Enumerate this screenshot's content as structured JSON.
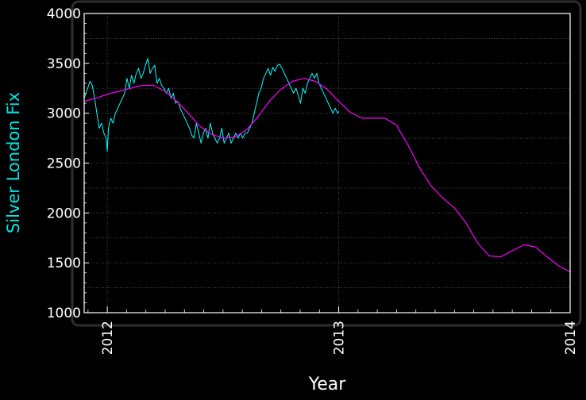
{
  "chart_data": {
    "type": "line",
    "title": "",
    "xlabel": "Year",
    "ylabel": "Silver London Fix",
    "xlim": [
      2011.9,
      2014.0
    ],
    "ylim": [
      1000,
      4000
    ],
    "yticks": [
      1000,
      1500,
      2000,
      2500,
      3000,
      3500,
      4000
    ],
    "ytick_labels": [
      "1000",
      "1500",
      "2000",
      "2500",
      "3000",
      "3500",
      "4000"
    ],
    "xticks": [
      2012,
      2013,
      2014
    ],
    "xtick_labels": [
      "2012",
      "2013",
      "2014"
    ],
    "grid": true,
    "legend": "none",
    "colors": {
      "background": "#000000",
      "plot_border": "#ffffff",
      "grid": "#555555",
      "ylabel": "#00e5e5",
      "text": "#ffffff"
    },
    "series": [
      {
        "color": "#00ffff",
        "x": [
          2011.9,
          2011.915,
          2011.925,
          2011.935,
          2011.945,
          2011.955,
          2011.965,
          2011.975,
          2011.985,
          2011.995,
          2012.0,
          2012.005,
          2012.015,
          2012.025,
          2012.035,
          2012.045,
          2012.055,
          2012.065,
          2012.075,
          2012.085,
          2012.095,
          2012.105,
          2012.115,
          2012.125,
          2012.135,
          2012.145,
          2012.155,
          2012.165,
          2012.175,
          2012.185,
          2012.195,
          2012.205,
          2012.215,
          2012.225,
          2012.235,
          2012.245,
          2012.255,
          2012.265,
          2012.275,
          2012.285,
          2012.295,
          2012.305,
          2012.315,
          2012.325,
          2012.335,
          2012.345,
          2012.355,
          2012.365,
          2012.375,
          2012.385,
          2012.395,
          2012.405,
          2012.415,
          2012.425,
          2012.435,
          2012.445,
          2012.455,
          2012.465,
          2012.475,
          2012.485,
          2012.495,
          2012.505,
          2012.515,
          2012.525,
          2012.535,
          2012.545,
          2012.555,
          2012.565,
          2012.575,
          2012.585,
          2012.595,
          2012.605,
          2012.615,
          2012.625,
          2012.635,
          2012.645,
          2012.655,
          2012.665,
          2012.675,
          2012.685,
          2012.695,
          2012.705,
          2012.715,
          2012.725,
          2012.735,
          2012.745,
          2012.755,
          2012.765,
          2012.775,
          2012.785,
          2012.795,
          2012.805,
          2012.815,
          2012.825,
          2012.835,
          2012.845,
          2012.855,
          2012.865,
          2012.875,
          2012.885,
          2012.895,
          2012.905,
          2012.915,
          2012.925,
          2012.935,
          2012.945,
          2012.955,
          2012.965,
          2012.975,
          2012.985,
          2012.995,
          2013.0
        ],
        "values": [
          3150,
          3250,
          3320,
          3280,
          3150,
          3000,
          2850,
          2900,
          2800,
          2750,
          2620,
          2850,
          2950,
          2900,
          3000,
          3050,
          3100,
          3150,
          3200,
          3350,
          3250,
          3380,
          3300,
          3400,
          3450,
          3350,
          3400,
          3480,
          3550,
          3400,
          3450,
          3480,
          3300,
          3350,
          3280,
          3250,
          3200,
          3250,
          3150,
          3200,
          3100,
          3120,
          3050,
          3000,
          2950,
          2900,
          2850,
          2780,
          2750,
          2900,
          2800,
          2700,
          2800,
          2850,
          2750,
          2900,
          2800,
          2750,
          2700,
          2750,
          2850,
          2700,
          2750,
          2800,
          2700,
          2750,
          2800,
          2750,
          2800,
          2750,
          2800,
          2800,
          2850,
          2900,
          3000,
          3100,
          3200,
          3250,
          3350,
          3400,
          3450,
          3380,
          3460,
          3420,
          3480,
          3490,
          3450,
          3400,
          3350,
          3300,
          3250,
          3200,
          3250,
          3180,
          3100,
          3250,
          3200,
          3300,
          3350,
          3400,
          3350,
          3400,
          3300,
          3250,
          3200,
          3150,
          3100,
          3050,
          3000,
          3050,
          3000,
          3020
        ]
      },
      {
        "color": "#ff00ff",
        "x": [
          2011.9,
          2011.95,
          2012.0,
          2012.05,
          2012.1,
          2012.15,
          2012.2,
          2012.25,
          2012.3,
          2012.35,
          2012.4,
          2012.45,
          2012.5,
          2012.55,
          2012.6,
          2012.65,
          2012.7,
          2012.75,
          2012.8,
          2012.85,
          2012.9,
          2012.95,
          2013.0,
          2013.05,
          2013.1,
          2013.15,
          2013.2,
          2013.25,
          2013.3,
          2013.35,
          2013.4,
          2013.45,
          2013.5,
          2013.55,
          2013.6,
          2013.65,
          2013.7,
          2013.75,
          2013.8,
          2013.85,
          2013.9,
          2013.95,
          2014.0
        ],
        "values": [
          3120,
          3150,
          3190,
          3220,
          3250,
          3280,
          3280,
          3220,
          3120,
          3000,
          2870,
          2790,
          2750,
          2760,
          2830,
          2960,
          3120,
          3240,
          3320,
          3350,
          3320,
          3240,
          3120,
          3010,
          2950,
          2950,
          2950,
          2880,
          2680,
          2450,
          2270,
          2150,
          2050,
          1900,
          1700,
          1570,
          1560,
          1620,
          1680,
          1660,
          1560,
          1470,
          1410
        ]
      }
    ]
  }
}
